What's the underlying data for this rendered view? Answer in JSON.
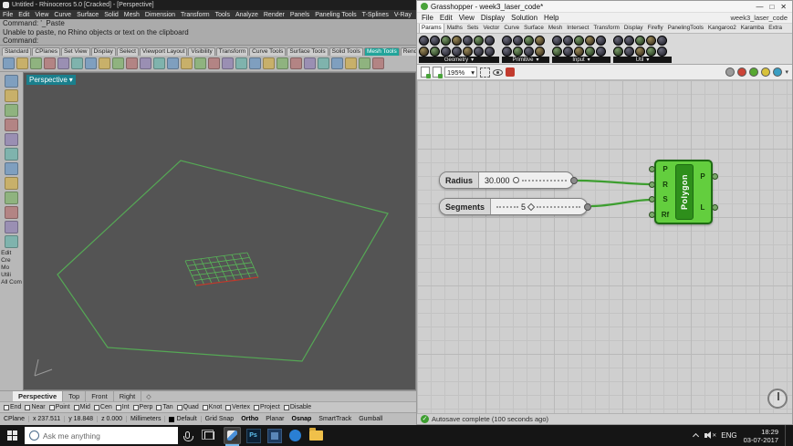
{
  "icons": {
    "dropdown_arrow": "▾",
    "viewport_diamond": "◇",
    "minimize": "—",
    "maximize": "□",
    "close": "✕",
    "autosave_check": "✓",
    "mute_x": "✕"
  },
  "rhino": {
    "title": "Untitled - Rhinoceros 5.0 [Cracked] - [Perspective]",
    "menu": [
      "File",
      "Edit",
      "View",
      "Curve",
      "Surface",
      "Solid",
      "Mesh",
      "Dimension",
      "Transform",
      "Tools",
      "Analyze",
      "Render",
      "Panels",
      "Paneling Tools",
      "T-Splines",
      "V-Ray",
      "Help"
    ],
    "command": {
      "line1": "Command: '_Paste",
      "line2": "Unable to paste, no Rhino objects or text on the clipboard",
      "line3": "Command:"
    },
    "toolbar_tabs": [
      "Standard",
      "CPlanes",
      "Set View",
      "Display",
      "Select",
      "Viewport Layout",
      "Visibility",
      "Transform",
      "Curve Tools",
      "Surface Tools",
      "Solid Tools",
      "Mesh Tools",
      "Render Tools"
    ],
    "sidebar_labels": [
      "Edit",
      "Cre",
      "Mo",
      "Utili",
      "All Com"
    ],
    "viewport": {
      "label": "Perspective"
    },
    "viewport_tabs": [
      "Perspective",
      "Top",
      "Front",
      "Right"
    ],
    "osnap": [
      "End",
      "Near",
      "Point",
      "Mid",
      "Cen",
      "Int",
      "Perp",
      "Tan",
      "Quad",
      "Knot",
      "Vertex",
      "Project",
      "Disable"
    ],
    "status": {
      "cplane": "CPlane",
      "x": "x 237.511",
      "y": "y 18.848",
      "z": "z 0.000",
      "units": "Millimeters",
      "layer": "Default",
      "toggles": [
        "Grid Snap",
        "Ortho",
        "Planar",
        "Osnap",
        "SmartTrack",
        "Gumball"
      ]
    }
  },
  "grasshopper": {
    "title": "Grasshopper - week3_laser_code*",
    "doc_name": "week3_laser_code",
    "menu": [
      "File",
      "Edit",
      "View",
      "Display",
      "Solution",
      "Help"
    ],
    "tabs": [
      "Params",
      "Maths",
      "Sets",
      "Vector",
      "Curve",
      "Surface",
      "Mesh",
      "Intersect",
      "Transform",
      "Display",
      "Firefly",
      "PanelingTools",
      "Kangaroo2",
      "Karamba",
      "Extra"
    ],
    "palette_groups": [
      {
        "label": "Geometry"
      },
      {
        "label": "Primitive"
      },
      {
        "label": "Input"
      },
      {
        "label": "Util"
      }
    ],
    "zoom": "195%",
    "sliders": [
      {
        "label": "Radius",
        "value": "30.000"
      },
      {
        "label": "Segments",
        "value": "5"
      }
    ],
    "component": {
      "name": "Polygon",
      "inputs": [
        "P",
        "R",
        "S",
        "Rf"
      ],
      "outputs": [
        "P",
        "L"
      ]
    },
    "status": "Autosave complete (100 seconds ago)"
  },
  "taskbar": {
    "search_placeholder": "Ask me anything",
    "photoshop_label": "Ps",
    "tray": {
      "language": "ENG",
      "time": "18:29",
      "date": "03-07-2017"
    }
  }
}
